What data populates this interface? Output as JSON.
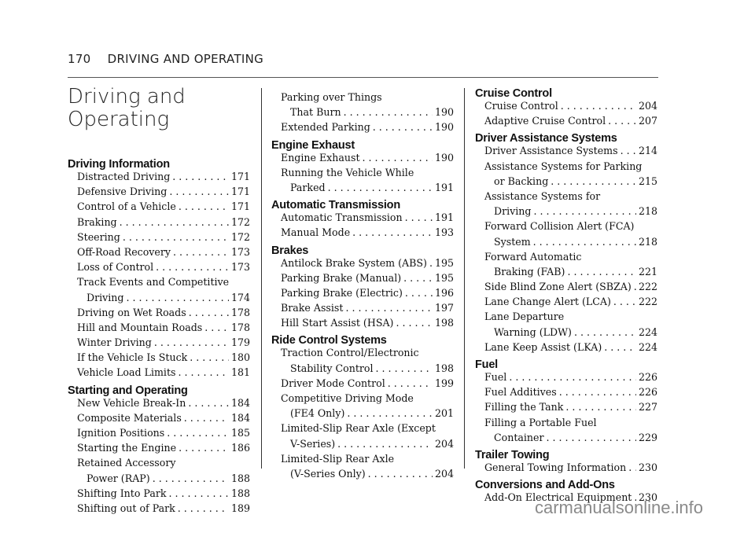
{
  "header": {
    "page_number": "170",
    "section": "DRIVING AND OPERATING"
  },
  "title": [
    "Driving and",
    "Operating"
  ],
  "columns": [
    [
      {
        "h": "Driving Information"
      },
      {
        "t": "Distracted Driving",
        "p": "171"
      },
      {
        "t": "Defensive Driving",
        "p": "171"
      },
      {
        "t": "Control of a Vehicle",
        "p": "171"
      },
      {
        "t": "Braking",
        "p": "172"
      },
      {
        "t": "Steering",
        "p": "172"
      },
      {
        "t": "Off-Road Recovery",
        "p": "173"
      },
      {
        "t": "Loss of Control",
        "p": "173"
      },
      {
        "t": "Track Events and Competitive",
        "c": "Driving",
        "p": "174"
      },
      {
        "t": "Driving on Wet Roads",
        "p": "178"
      },
      {
        "t": "Hill and Mountain Roads",
        "p": "178"
      },
      {
        "t": "Winter Driving",
        "p": "179"
      },
      {
        "t": "If the Vehicle Is Stuck",
        "p": "180"
      },
      {
        "t": "Vehicle Load Limits",
        "p": "181"
      },
      {
        "h": "Starting and Operating"
      },
      {
        "t": "New Vehicle Break-In",
        "p": "184"
      },
      {
        "t": "Composite Materials",
        "p": "184"
      },
      {
        "t": "Ignition Positions",
        "p": "185"
      },
      {
        "t": "Starting the Engine",
        "p": "186"
      },
      {
        "t": "Retained Accessory",
        "c": "Power (RAP)",
        "p": "188"
      },
      {
        "t": "Shifting Into Park",
        "p": "188"
      },
      {
        "t": "Shifting out of Park",
        "p": "189"
      }
    ],
    [
      {
        "t": "Parking over Things",
        "c": "That Burn",
        "p": "190"
      },
      {
        "t": "Extended Parking",
        "p": "190"
      },
      {
        "h": "Engine Exhaust"
      },
      {
        "t": "Engine Exhaust",
        "p": "190"
      },
      {
        "t": "Running the Vehicle While",
        "c": "Parked",
        "p": "191"
      },
      {
        "h": "Automatic Transmission"
      },
      {
        "t": "Automatic Transmission",
        "p": "191"
      },
      {
        "t": "Manual Mode",
        "p": "193"
      },
      {
        "h": "Brakes"
      },
      {
        "t": "Antilock Brake System (ABS)",
        "p": "195"
      },
      {
        "t": "Parking Brake (Manual)",
        "p": "195"
      },
      {
        "t": "Parking Brake (Electric)",
        "p": "196"
      },
      {
        "t": "Brake Assist",
        "p": "197"
      },
      {
        "t": "Hill Start Assist (HSA)",
        "p": "198"
      },
      {
        "h": "Ride Control Systems"
      },
      {
        "t": "Traction Control/Electronic",
        "c": "Stability Control",
        "p": "198"
      },
      {
        "t": "Driver Mode Control",
        "p": "199"
      },
      {
        "t": "Competitive Driving Mode",
        "c": "(FE4 Only)",
        "p": "201"
      },
      {
        "t": "Limited-Slip Rear Axle (Except",
        "c": "V-Series)",
        "p": "204"
      },
      {
        "t": "Limited-Slip Rear Axle",
        "c": "(V-Series Only)",
        "p": "204"
      }
    ],
    [
      {
        "h": "Cruise Control"
      },
      {
        "t": "Cruise Control",
        "p": "204"
      },
      {
        "t": "Adaptive Cruise Control",
        "p": "207"
      },
      {
        "h": "Driver Assistance Systems"
      },
      {
        "t": "Driver Assistance Systems",
        "p": "214"
      },
      {
        "t": "Assistance Systems for Parking",
        "c": "or Backing",
        "p": "215"
      },
      {
        "t": "Assistance Systems for",
        "c": "Driving",
        "p": "218"
      },
      {
        "t": "Forward Collision Alert (FCA)",
        "c": "System",
        "p": "218"
      },
      {
        "t": "Forward Automatic",
        "c": "Braking (FAB)",
        "p": "221"
      },
      {
        "t": "Side Blind Zone Alert (SBZA)",
        "p": "222"
      },
      {
        "t": "Lane Change Alert (LCA)",
        "p": "222"
      },
      {
        "t": "Lane Departure",
        "c": "Warning (LDW)",
        "p": "224"
      },
      {
        "t": "Lane Keep Assist (LKA)",
        "p": "224"
      },
      {
        "h": "Fuel"
      },
      {
        "t": "Fuel",
        "p": "226"
      },
      {
        "t": "Fuel Additives",
        "p": "226"
      },
      {
        "t": "Filling the Tank",
        "p": "227"
      },
      {
        "t": "Filling a Portable Fuel",
        "c": "Container",
        "p": "229"
      },
      {
        "h": "Trailer Towing"
      },
      {
        "t": "General Towing Information",
        "p": "230"
      },
      {
        "h": "Conversions and Add-Ons"
      },
      {
        "t": "Add-On Electrical Equipment",
        "p": "230"
      }
    ]
  ],
  "watermark": "carmanualsonline.info"
}
